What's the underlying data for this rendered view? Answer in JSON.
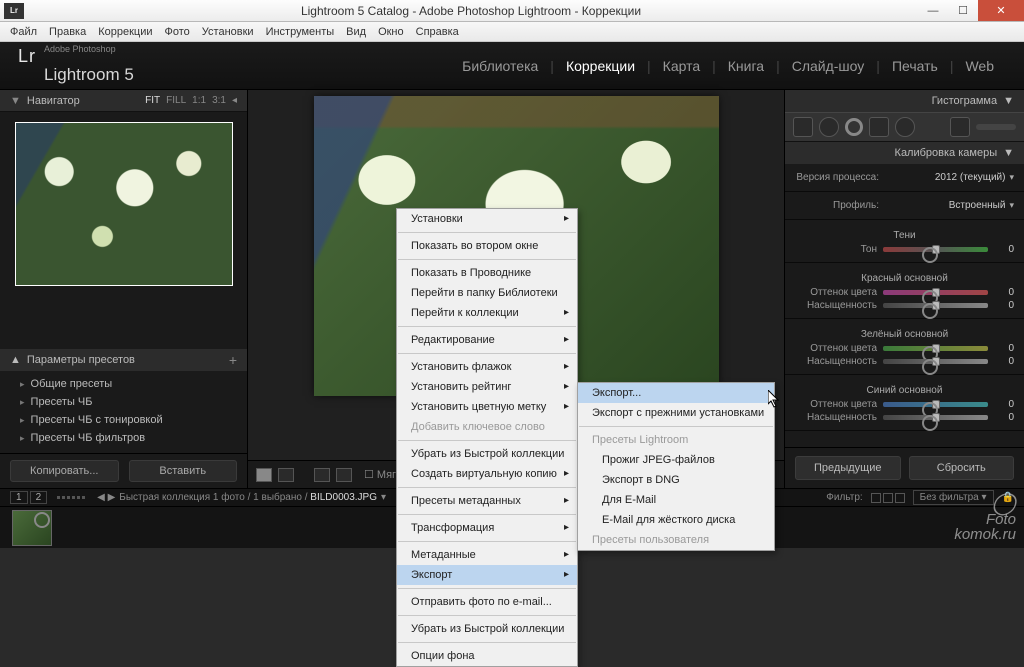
{
  "titlebar": {
    "title": "Lightroom 5 Catalog - Adobe Photoshop Lightroom - Коррекции",
    "app_icon": "Lr"
  },
  "menubar": [
    "Файл",
    "Правка",
    "Коррекции",
    "Фото",
    "Установки",
    "Инструменты",
    "Вид",
    "Окно",
    "Справка"
  ],
  "logo": {
    "lr": "Lr",
    "sub": "Adobe Photoshop",
    "name": "Lightroom 5"
  },
  "modules": [
    "Библиотека",
    "Коррекции",
    "Карта",
    "Книга",
    "Слайд-шоу",
    "Печать",
    "Web"
  ],
  "module_active_index": 1,
  "left": {
    "navigator": "Навигатор",
    "nav_opts": [
      "FIT",
      "FILL",
      "1:1",
      "3:1"
    ],
    "presets_header": "Параметры пресетов",
    "presets": [
      "Общие пресеты",
      "Пресеты ЧБ",
      "Пресеты ЧБ с тонировкой",
      "Пресеты ЧБ фильтров"
    ],
    "btn_copy": "Копировать...",
    "btn_paste": "Вставить"
  },
  "center": {
    "toolbar_label": "Мягкая ц"
  },
  "right": {
    "histogram": "Гистограмма",
    "calib": "Калибровка камеры",
    "process_lbl": "Версия процесса:",
    "process_val": "2012 (текущий)",
    "profile_lbl": "Профиль:",
    "profile_val": "Встроенный",
    "shadows": "Тени",
    "tone": "Тон",
    "red": "Красный основной",
    "green": "Зелёный основной",
    "blue": "Синий основной",
    "hue": "Оттенок цвета",
    "sat": "Насыщенность",
    "btn_prev": "Предыдущие",
    "btn_reset": "Сбросить"
  },
  "bottom": {
    "pages": [
      "1",
      "2"
    ],
    "collection": "Быстрая коллекция",
    "count": "1 фото /",
    "sel": "1 выбрано /",
    "fname": "BILD0003.JPG",
    "filter_lbl": "Фильтр:",
    "filter_val": "Без фильтра"
  },
  "ctx1": [
    {
      "t": "Установки",
      "sub": true
    },
    {
      "hr": true
    },
    {
      "t": "Показать во втором окне"
    },
    {
      "hr": true
    },
    {
      "t": "Показать в Проводнике"
    },
    {
      "t": "Перейти в папку Библиотеки"
    },
    {
      "t": "Перейти к коллекции",
      "sub": true
    },
    {
      "hr": true
    },
    {
      "t": "Редактирование",
      "sub": true
    },
    {
      "hr": true
    },
    {
      "t": "Установить флажок",
      "sub": true
    },
    {
      "t": "Установить рейтинг",
      "sub": true
    },
    {
      "t": "Установить цветную метку",
      "sub": true
    },
    {
      "t": "Добавить ключевое слово",
      "disabled": true
    },
    {
      "hr": true
    },
    {
      "t": "Убрать из Быстрой коллекции"
    },
    {
      "t": "Создать виртуальную копию",
      "sub": true
    },
    {
      "hr": true
    },
    {
      "t": "Пресеты метаданных",
      "sub": true
    },
    {
      "hr": true
    },
    {
      "t": "Трансформация",
      "sub": true
    },
    {
      "hr": true
    },
    {
      "t": "Метаданные",
      "sub": true
    },
    {
      "t": "Экспорт",
      "sub": true,
      "hover": true
    },
    {
      "hr": true
    },
    {
      "t": "Отправить фото по e-mail..."
    },
    {
      "hr": true
    },
    {
      "t": "Убрать из Быстрой коллекции"
    },
    {
      "hr": true
    },
    {
      "t": "Опции фона"
    }
  ],
  "ctx2": [
    {
      "t": "Экспорт...",
      "hover": true
    },
    {
      "t": "Экспорт с прежними установками"
    },
    {
      "hr": true
    },
    {
      "t": "Пресеты Lightroom",
      "disabled": true
    },
    {
      "t": "Прожиг JPEG-файлов",
      "indent": true
    },
    {
      "t": "Экспорт в DNG",
      "indent": true
    },
    {
      "t": "Для E-Mail",
      "indent": true
    },
    {
      "t": "E-Mail для жёсткого диска",
      "indent": true
    },
    {
      "t": "Пресеты пользователя",
      "disabled": true
    }
  ],
  "watermark": {
    "line1": "Foto",
    "line2": "komok.ru"
  }
}
